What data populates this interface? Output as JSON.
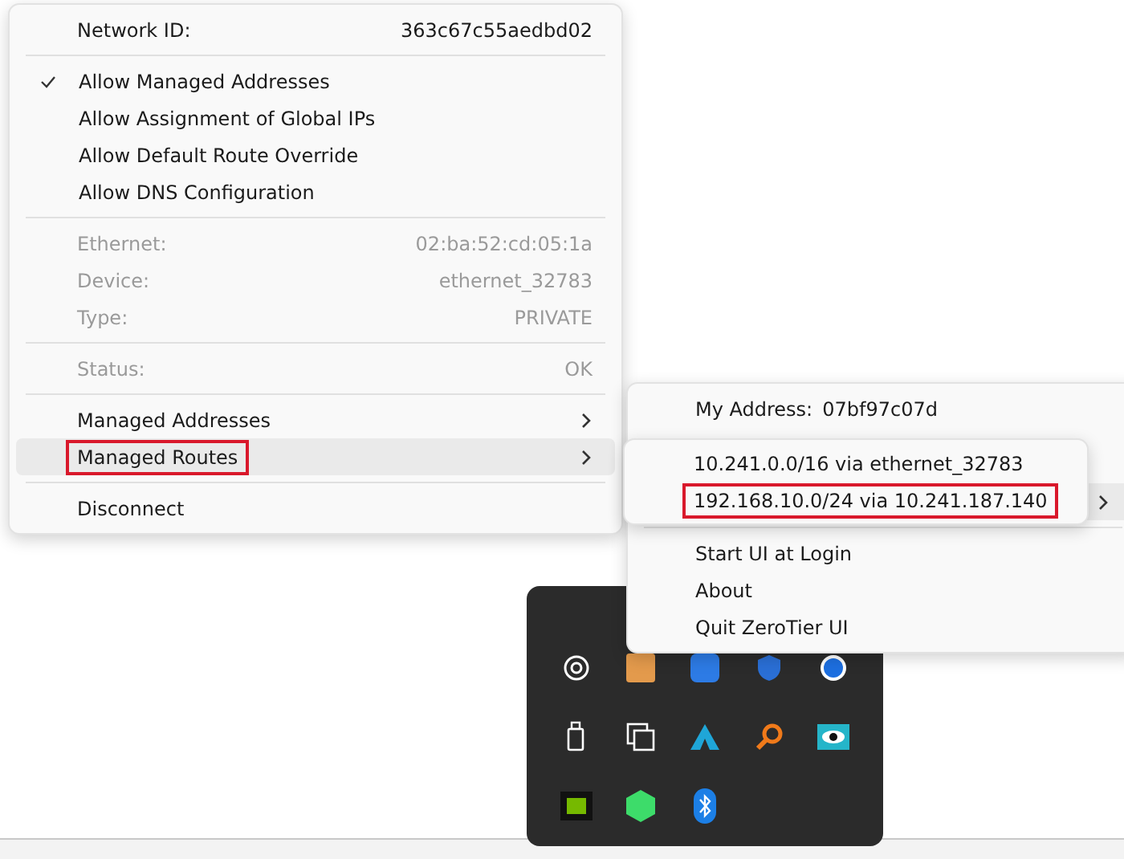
{
  "network_menu": {
    "items": [
      {
        "kind": "info",
        "label": "Network ID:",
        "value": "363c67c55aedbd02",
        "disabled": false
      },
      {
        "kind": "separator"
      },
      {
        "kind": "check",
        "label": "Allow Managed Addresses",
        "checked": true
      },
      {
        "kind": "check",
        "label": "Allow Assignment of Global IPs",
        "checked": false
      },
      {
        "kind": "check",
        "label": "Allow Default Route Override",
        "checked": false
      },
      {
        "kind": "check",
        "label": "Allow DNS Configuration",
        "checked": false
      },
      {
        "kind": "separator"
      },
      {
        "kind": "info",
        "label": "Ethernet:",
        "value": "02:ba:52:cd:05:1a",
        "disabled": true
      },
      {
        "kind": "info",
        "label": "Device:",
        "value": "ethernet_32783",
        "disabled": true
      },
      {
        "kind": "info",
        "label": "Type:",
        "value": "PRIVATE",
        "disabled": true
      },
      {
        "kind": "separator"
      },
      {
        "kind": "info",
        "label": "Status:",
        "value": "OK",
        "disabled": true
      },
      {
        "kind": "separator"
      },
      {
        "kind": "submenu",
        "label": "Managed Addresses",
        "hovered": false,
        "outlined": false
      },
      {
        "kind": "submenu",
        "label": "Managed Routes",
        "hovered": true,
        "outlined": true
      },
      {
        "kind": "separator"
      },
      {
        "kind": "action",
        "label": "Disconnect"
      }
    ]
  },
  "main_menu": {
    "items": [
      {
        "kind": "address",
        "label": "My Address:",
        "value": "07bf97c07d"
      },
      {
        "kind": "covered"
      },
      {
        "kind": "submenu",
        "hovered": true
      },
      {
        "kind": "separator"
      },
      {
        "kind": "action",
        "label": "Start UI at Login"
      },
      {
        "kind": "action",
        "label": "About"
      },
      {
        "kind": "action",
        "label": "Quit ZeroTier UI"
      }
    ]
  },
  "routes_menu": {
    "items": [
      {
        "label": "10.241.0.0/16 via ethernet_32783",
        "outlined": false
      },
      {
        "label": "192.168.10.0/24 via 10.241.187.140",
        "outlined": true
      }
    ]
  }
}
